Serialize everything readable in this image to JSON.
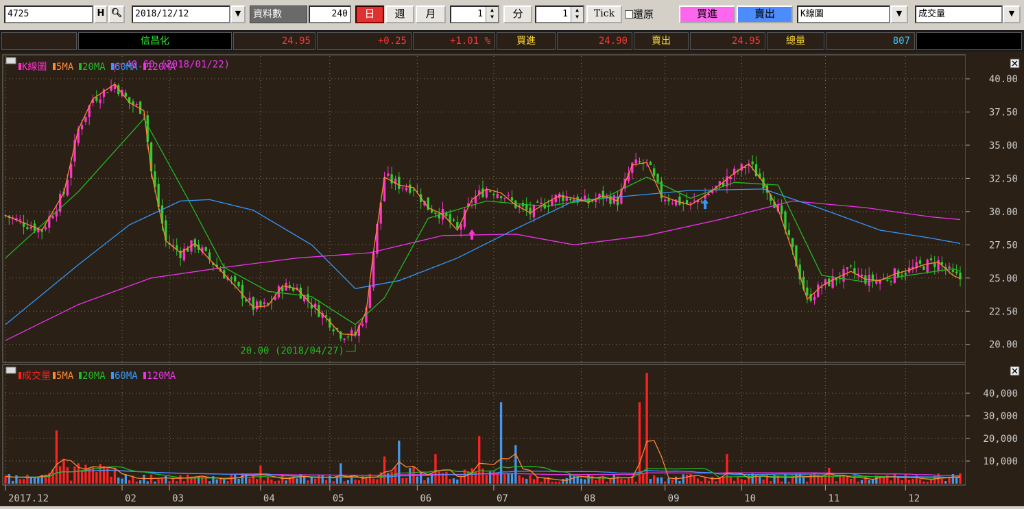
{
  "toolbar": {
    "symbol": "4725",
    "history_label": "H",
    "date": "2018/12/12",
    "data_count_label": "資料數",
    "data_count": "240",
    "day_label": "日",
    "week_label": "週",
    "month_label": "月",
    "minute_value": "1",
    "minute_label": "分",
    "tick_value": "1",
    "tick_label": "Tick",
    "restore_label": "還原",
    "buy_label": "買進",
    "sell_label": "賣出",
    "chart_type": "K線圖",
    "indicator": "成交量"
  },
  "quote": {
    "name": "信昌化",
    "price": "24.95",
    "change": "+0.25",
    "change_pct": "+1.01 %",
    "bid_label": "買進",
    "bid": "24.90",
    "ask_label": "賣出",
    "ask": "24.95",
    "volume_label": "總量",
    "volume": "807"
  },
  "colors": {
    "up": "#ff33cc",
    "down": "#33cc33",
    "ma5": "#ff8833",
    "ma20": "#22bb22",
    "ma60": "#3399ff",
    "ma120": "#ee33ee",
    "vol_up": "#ff2222",
    "vol_down": "#4499ee",
    "grid": "#8a7a5a",
    "axis_text": "#cccccc"
  },
  "chart_data": [
    {
      "type": "candlestick",
      "legend": [
        "K線圖",
        "5MA",
        "20MA",
        "60MA",
        "120MA"
      ],
      "ylim": [
        18.8,
        41.6
      ],
      "yticks": [
        "40.00",
        "37.50",
        "35.00",
        "32.50",
        "30.00",
        "27.50",
        "25.00",
        "22.50",
        "20.00"
      ],
      "annotations": [
        {
          "text": "40.60 (2018/01/22)",
          "value": 40.6
        },
        {
          "text": "20.00 (2018/04/27)",
          "value": 20.0
        }
      ],
      "close_path": [
        [
          0,
          29.7
        ],
        [
          10,
          28.6
        ],
        [
          16,
          31.4
        ],
        [
          20,
          36.2
        ],
        [
          24,
          38.5
        ],
        [
          30,
          39.6
        ],
        [
          34,
          38.2
        ],
        [
          38,
          37.6
        ],
        [
          40,
          33.0
        ],
        [
          44,
          27.8
        ],
        [
          48,
          26.9
        ],
        [
          52,
          27.6
        ],
        [
          56,
          26.4
        ],
        [
          60,
          25.3
        ],
        [
          64,
          24.1
        ],
        [
          68,
          22.8
        ],
        [
          72,
          22.9
        ],
        [
          76,
          24.4
        ],
        [
          80,
          24.2
        ],
        [
          84,
          23.0
        ],
        [
          88,
          22.0
        ],
        [
          92,
          20.8
        ],
        [
          96,
          20.7
        ],
        [
          99,
          22.5
        ],
        [
          101,
          27.0
        ],
        [
          104,
          32.6
        ],
        [
          108,
          32.0
        ],
        [
          112,
          31.8
        ],
        [
          116,
          30.3
        ],
        [
          120,
          29.8
        ],
        [
          124,
          28.6
        ],
        [
          128,
          30.9
        ],
        [
          132,
          31.7
        ],
        [
          136,
          31.4
        ],
        [
          140,
          30.5
        ],
        [
          144,
          29.9
        ],
        [
          148,
          30.6
        ],
        [
          152,
          31.2
        ],
        [
          156,
          31.0
        ],
        [
          160,
          30.7
        ],
        [
          164,
          31.2
        ],
        [
          168,
          30.8
        ],
        [
          172,
          33.5
        ],
        [
          176,
          33.7
        ],
        [
          180,
          31.2
        ],
        [
          184,
          30.8
        ],
        [
          188,
          30.5
        ],
        [
          192,
          31.2
        ],
        [
          196,
          32.0
        ],
        [
          200,
          32.9
        ],
        [
          204,
          33.6
        ],
        [
          208,
          32.2
        ],
        [
          212,
          30.2
        ],
        [
          216,
          27.0
        ],
        [
          220,
          23.4
        ],
        [
          224,
          24.4
        ],
        [
          228,
          25.0
        ],
        [
          232,
          25.5
        ],
        [
          236,
          24.9
        ],
        [
          240,
          24.8
        ],
        [
          244,
          25.3
        ],
        [
          248,
          25.6
        ],
        [
          252,
          26.0
        ],
        [
          256,
          26.2
        ],
        [
          260,
          25.2
        ],
        [
          262,
          24.95
        ]
      ],
      "ma20": [
        [
          0,
          26.5
        ],
        [
          20,
          31.5
        ],
        [
          38,
          37.0
        ],
        [
          50,
          31.0
        ],
        [
          60,
          25.8
        ],
        [
          72,
          24.0
        ],
        [
          84,
          23.6
        ],
        [
          96,
          21.5
        ],
        [
          104,
          23.5
        ],
        [
          116,
          29.5
        ],
        [
          132,
          30.8
        ],
        [
          148,
          30.4
        ],
        [
          164,
          31.0
        ],
        [
          176,
          32.6
        ],
        [
          188,
          31.0
        ],
        [
          200,
          32.2
        ],
        [
          212,
          32.0
        ],
        [
          224,
          25.2
        ],
        [
          236,
          24.7
        ],
        [
          248,
          25.2
        ],
        [
          260,
          25.7
        ],
        [
          262,
          25.5
        ]
      ],
      "ma60": [
        [
          0,
          21.5
        ],
        [
          20,
          26.0
        ],
        [
          34,
          29.0
        ],
        [
          48,
          30.8
        ],
        [
          56,
          30.9
        ],
        [
          68,
          30.1
        ],
        [
          84,
          27.5
        ],
        [
          96,
          24.2
        ],
        [
          108,
          24.8
        ],
        [
          124,
          26.5
        ],
        [
          140,
          28.7
        ],
        [
          156,
          30.8
        ],
        [
          172,
          31.2
        ],
        [
          188,
          31.6
        ],
        [
          208,
          31.7
        ],
        [
          224,
          30.2
        ],
        [
          240,
          28.6
        ],
        [
          254,
          28.0
        ],
        [
          262,
          27.6
        ]
      ],
      "ma120": [
        [
          0,
          20.3
        ],
        [
          20,
          23.0
        ],
        [
          40,
          25.0
        ],
        [
          60,
          25.8
        ],
        [
          80,
          26.5
        ],
        [
          100,
          26.9
        ],
        [
          120,
          28.2
        ],
        [
          140,
          28.3
        ],
        [
          156,
          27.5
        ],
        [
          176,
          28.2
        ],
        [
          196,
          29.4
        ],
        [
          216,
          30.8
        ],
        [
          236,
          30.3
        ],
        [
          254,
          29.6
        ],
        [
          262,
          29.4
        ]
      ],
      "buy_markers": [
        [
          128,
          28.2
        ]
      ],
      "sell_markers": [
        [
          192,
          30.5
        ]
      ]
    },
    {
      "type": "bar",
      "legend": [
        "成交量",
        "5MA",
        "20MA",
        "60MA",
        "120MA"
      ],
      "ylim": [
        0,
        50000
      ],
      "yticks": [
        "40,000",
        "30,000",
        "20,000",
        "10,000"
      ],
      "spikes": [
        [
          14,
          23500
        ],
        [
          16,
          11000
        ],
        [
          20,
          9000
        ],
        [
          30,
          7000
        ],
        [
          70,
          8000
        ],
        [
          92,
          9000
        ],
        [
          104,
          12000
        ],
        [
          108,
          19000
        ],
        [
          118,
          13000
        ],
        [
          130,
          21000
        ],
        [
          136,
          36000
        ],
        [
          140,
          17000
        ],
        [
          174,
          36000
        ],
        [
          176,
          49000
        ],
        [
          198,
          13000
        ],
        [
          226,
          7000
        ]
      ],
      "x_labels": [
        "2017.12",
        "02",
        "03",
        "04",
        "05",
        "06",
        "07",
        "08",
        "09",
        "10",
        "11",
        "12"
      ],
      "x_label_positions": [
        0,
        32,
        45,
        70,
        89,
        113,
        134,
        158,
        181,
        202,
        225,
        247
      ]
    }
  ]
}
